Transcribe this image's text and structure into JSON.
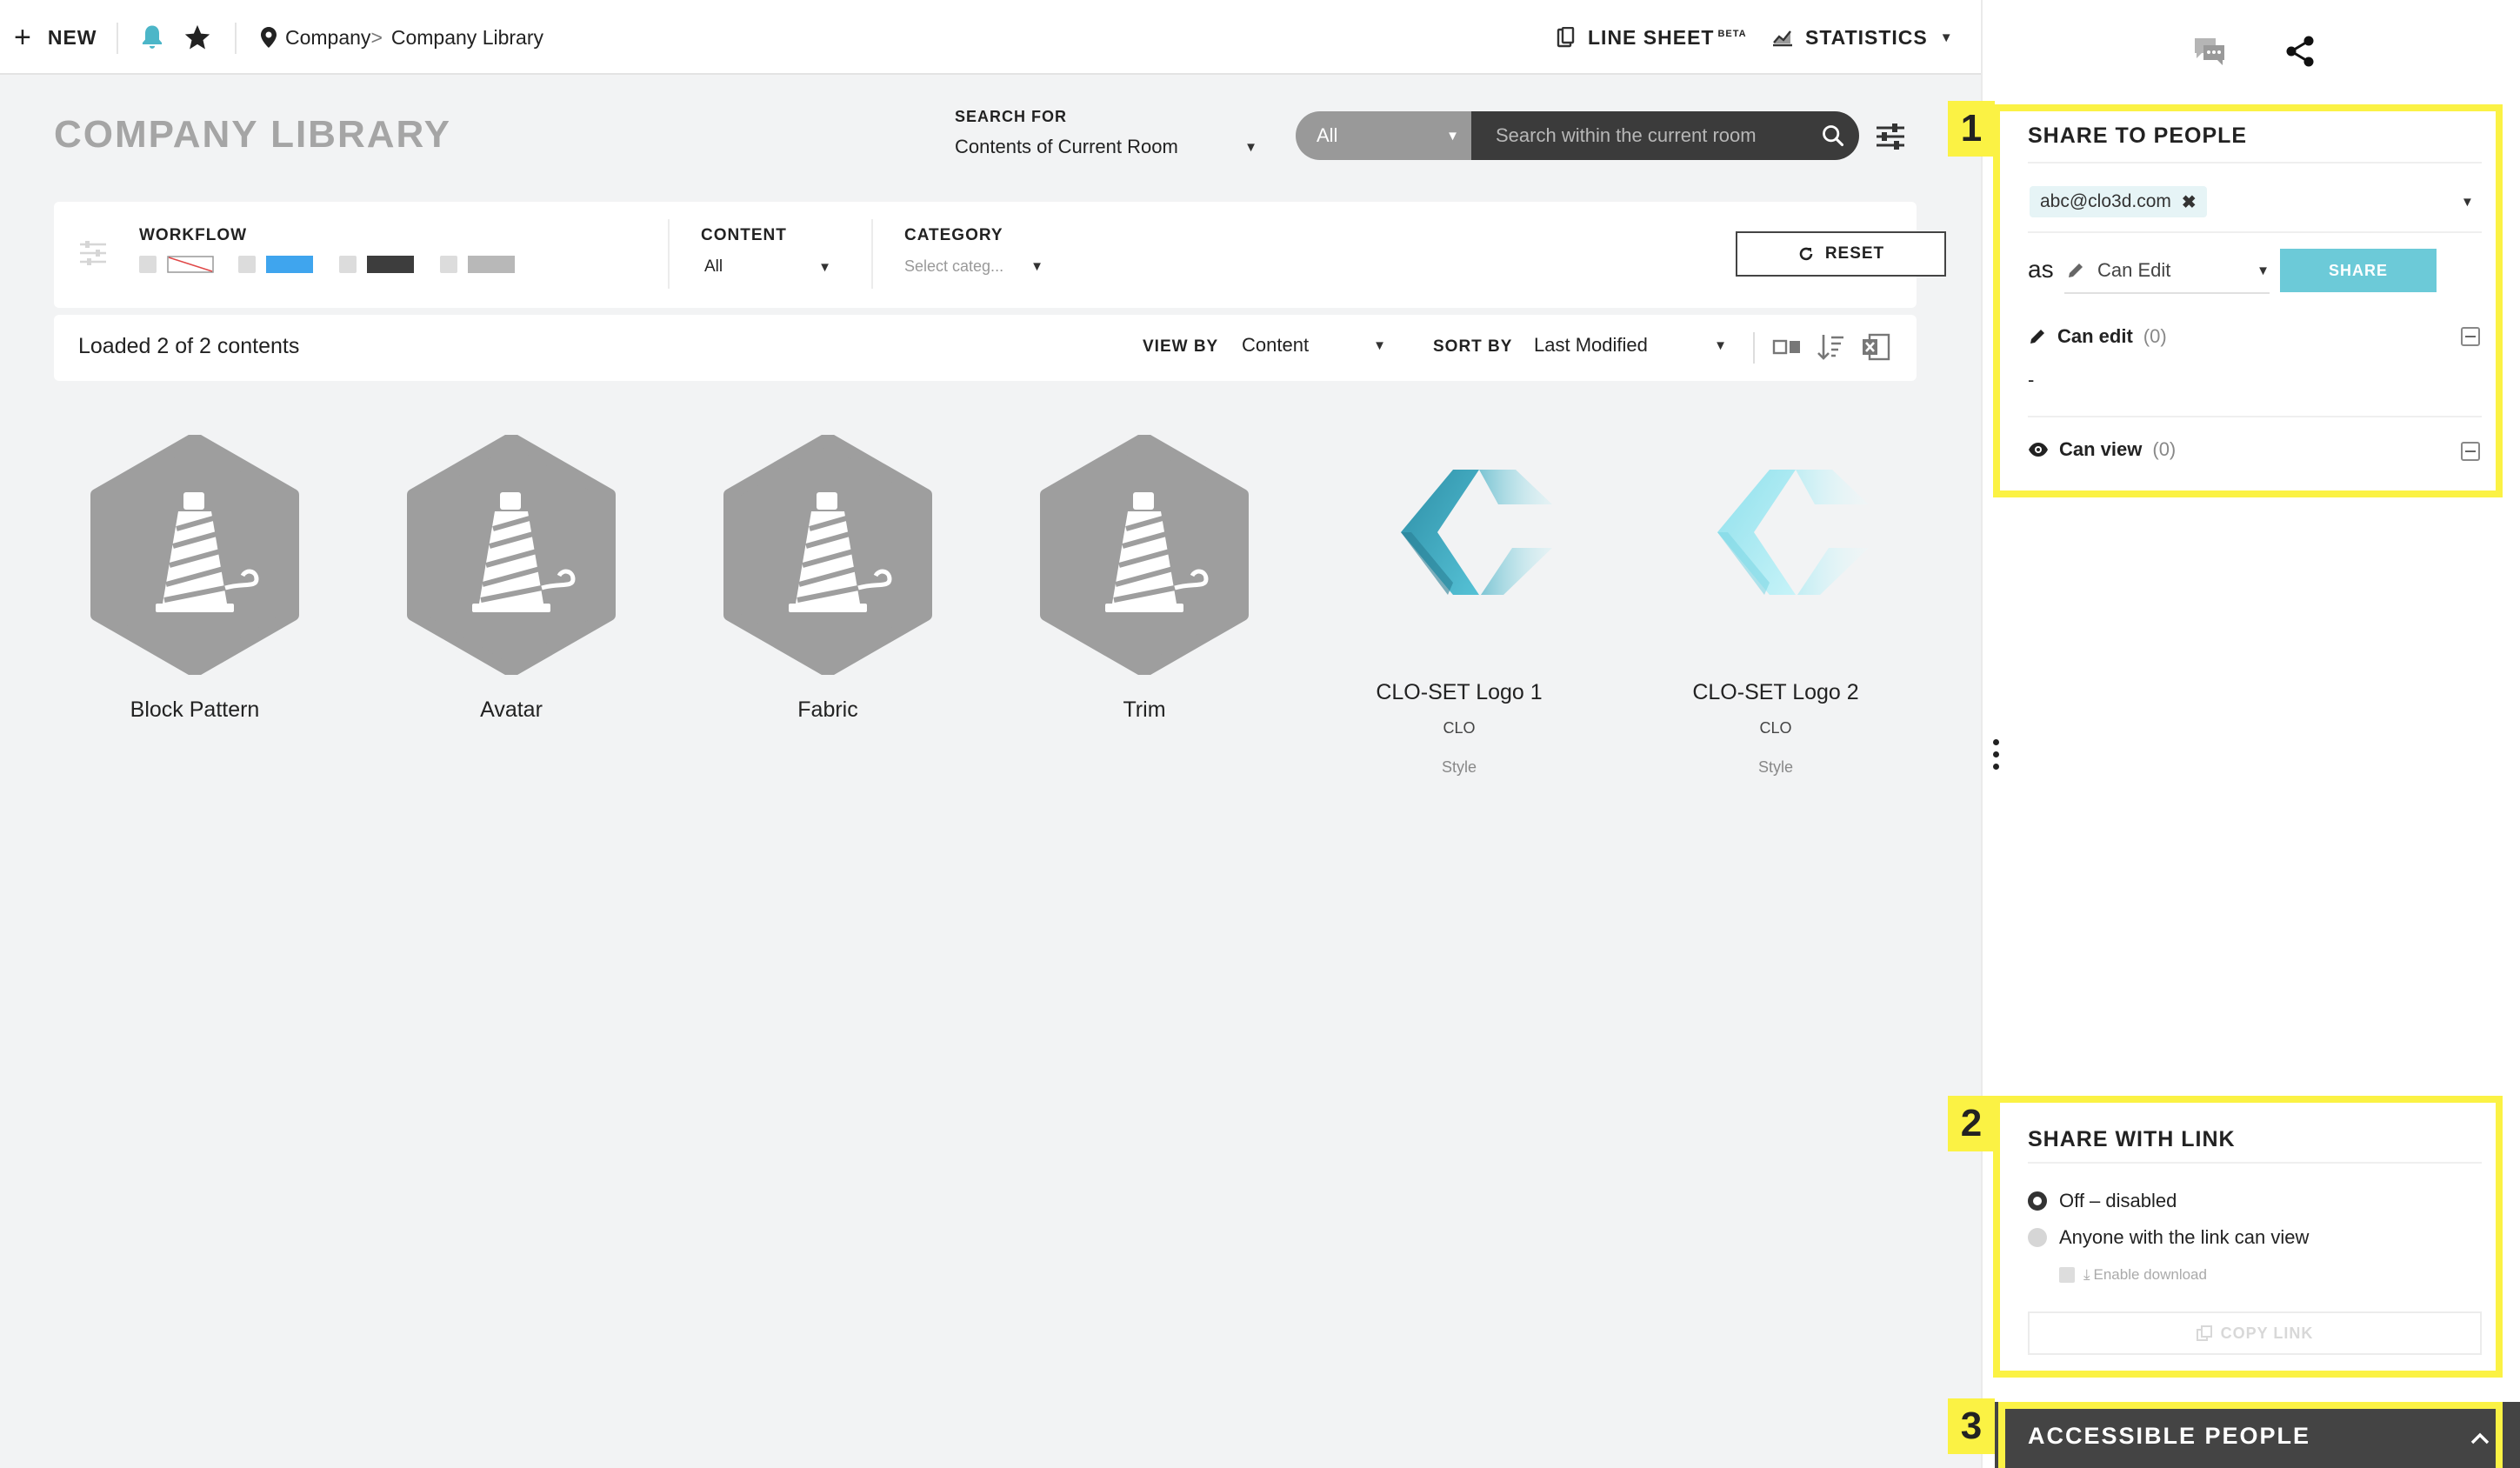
{
  "topbar": {
    "new_label": "NEW",
    "breadcrumb": {
      "root": "Company",
      "sep": ">",
      "current": "Company Library"
    },
    "line_sheet": "LINE SHEET",
    "line_sheet_badge": "BETA",
    "statistics": "STATISTICS"
  },
  "page": {
    "title": "COMPANY LIBRARY"
  },
  "search": {
    "for_label": "SEARCH FOR",
    "for_value": "Contents of Current Room",
    "scope": "All",
    "placeholder": "Search within the current room"
  },
  "filters": {
    "workflow_label": "WORKFLOW",
    "workflow_colors": [
      "none",
      "#3fa5ee",
      "#3d3d3d",
      "#b8b8b8"
    ],
    "content_label": "CONTENT",
    "content_value": "All",
    "category_label": "CATEGORY",
    "category_placeholder": "Select categ...",
    "reset_label": "RESET"
  },
  "results": {
    "loaded_text": "Loaded 2 of 2 contents",
    "view_by_label": "VIEW BY",
    "view_by_value": "Content",
    "sort_by_label": "SORT BY",
    "sort_by_value": "Last Modified"
  },
  "items": [
    {
      "name": "Block Pattern"
    },
    {
      "name": "Avatar"
    },
    {
      "name": "Fabric"
    },
    {
      "name": "Trim"
    },
    {
      "name": "CLO-SET Logo 1",
      "sub": "CLO",
      "type": "Style"
    },
    {
      "name": "CLO-SET Logo 2",
      "sub": "CLO",
      "type": "Style"
    }
  ],
  "panel": {
    "callouts": [
      "1",
      "2",
      "3"
    ],
    "share_people": {
      "title": "SHARE TO PEOPLE",
      "email": "abc@clo3d.com",
      "as_label": "as",
      "permission": "Can Edit",
      "share_button": "SHARE",
      "can_edit_label": "Can edit",
      "can_edit_count": "(0)",
      "can_edit_empty": "-",
      "can_view_label": "Can view",
      "can_view_count": "(0)"
    },
    "share_link": {
      "title": "SHARE WITH LINK",
      "option_off": "Off – disabled",
      "option_anyone": "Anyone with the link can view",
      "enable_download": "Enable download",
      "copy_link": "COPY LINK"
    },
    "accessible_people": {
      "title": "ACCESSIBLE PEOPLE"
    }
  },
  "colors": {
    "accent": "#6ccad8",
    "highlight": "#fbf244",
    "bell": "#4cb6c8",
    "hex_gray": "#9e9e9e"
  }
}
